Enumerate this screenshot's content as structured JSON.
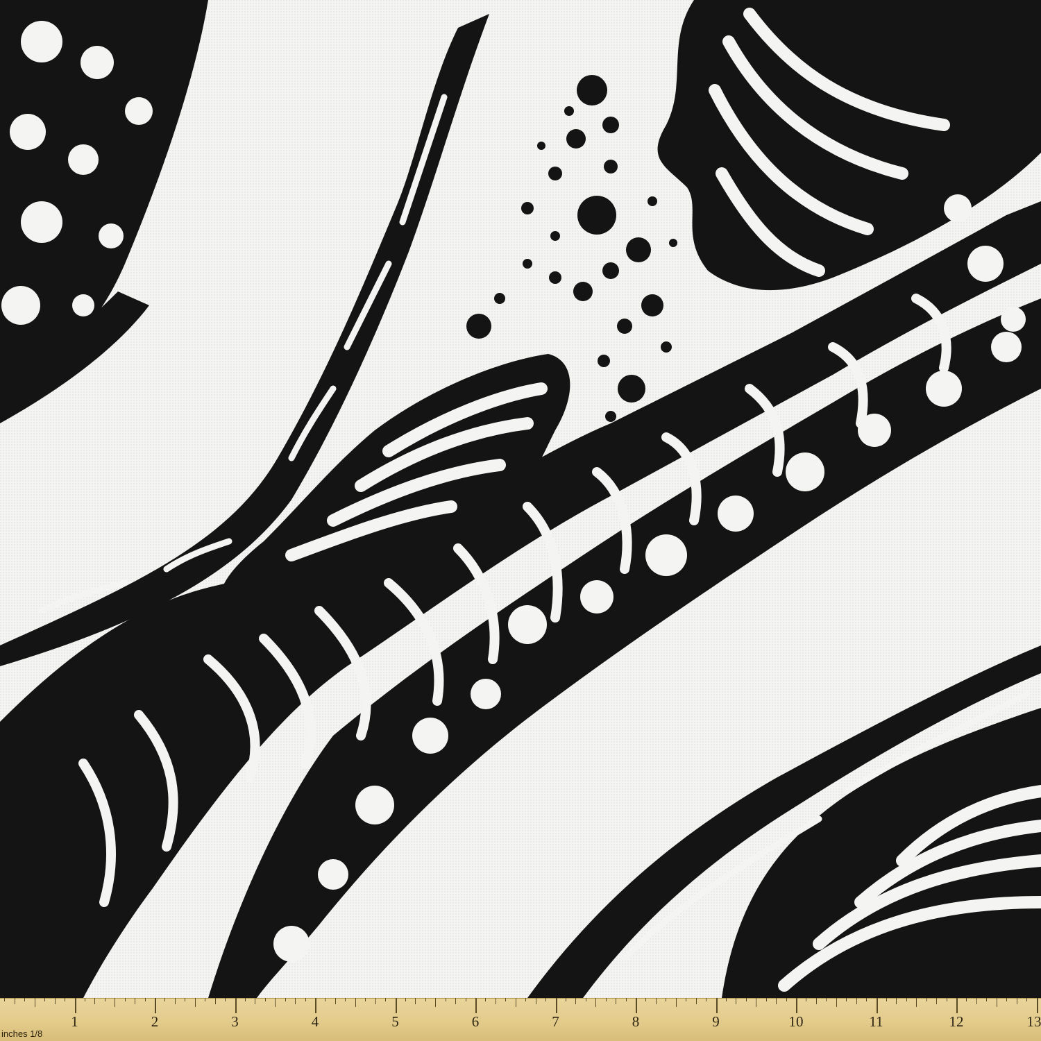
{
  "image": {
    "subject": "black and white abstract patchwork fabric print with zebra, swirl, dotted and floral bands",
    "colors": {
      "ink": "#141414",
      "fabric": "#f4f4f2",
      "ruler": "#e3cb8b"
    }
  },
  "ruler": {
    "unit_label": "inches 1/8",
    "numbers": [
      "1",
      "2",
      "3",
      "4",
      "5",
      "6",
      "7",
      "8",
      "9",
      "10",
      "11",
      "12",
      "13"
    ]
  }
}
